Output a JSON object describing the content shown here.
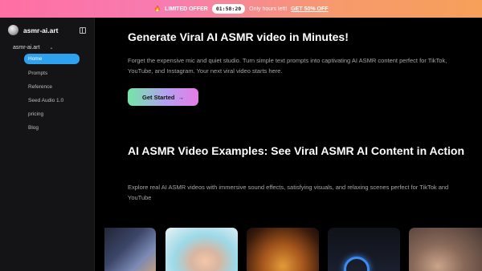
{
  "promo": {
    "fire_icon": "🔥",
    "label": "LIMITED OFFER",
    "timer": "01:58:20",
    "hours_text": "Only hours left!",
    "cta": "GET 50% OFF"
  },
  "sidebar": {
    "brand": "asmr-ai.art",
    "group": "asmr-ai.art",
    "items": [
      {
        "label": "Home",
        "active": true
      },
      {
        "label": "Prompts"
      },
      {
        "label": "Reference"
      },
      {
        "label": "Seed Audio 1.0"
      },
      {
        "label": "pricing"
      },
      {
        "label": "Blog"
      }
    ]
  },
  "hero": {
    "title": "Generate Viral AI ASMR video in Minutes!",
    "description": "Forget the expensive mic and quiet studio. Turn simple text prompts into captivating AI ASMR content perfect for TikTok, YouTube, and Instagram. Your next viral video starts here.",
    "button": "Get Started",
    "button_arrow": "→"
  },
  "examples": {
    "title": "AI ASMR Video Examples: See Viral ASMR AI Content in Action",
    "description": "Explore real AI ASMR videos with immersive sound effects, satisfying visuals, and relaxing scenes perfect for TikTok and YouTube"
  },
  "colors": {
    "active_nav": "#2fa2ef",
    "background": "#000000",
    "sidebar_bg": "#141416"
  }
}
